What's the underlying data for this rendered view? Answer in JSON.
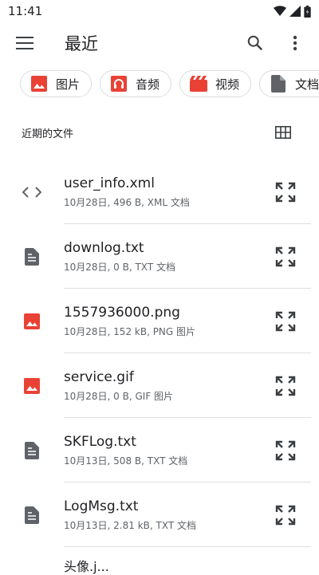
{
  "status": {
    "time": "11:41"
  },
  "appbar": {
    "title": "最近"
  },
  "chips": [
    {
      "label": "图片",
      "color": "#e94235"
    },
    {
      "label": "音频",
      "color": "#e94235"
    },
    {
      "label": "视频",
      "color": "#e94235"
    },
    {
      "label": "文档",
      "color": "#5f6368"
    }
  ],
  "section": {
    "title": "近期的文件"
  },
  "files": [
    {
      "name": "user_info.xml",
      "meta": "10月28日, 496 B, XML 文档",
      "icon": "code-icon"
    },
    {
      "name": "downlog.txt",
      "meta": "10月28日, 0 B, TXT 文档",
      "icon": "document-icon"
    },
    {
      "name": "1557936000.png",
      "meta": "10月28日, 152 kB, PNG 图片",
      "icon": "image-icon"
    },
    {
      "name": "service.gif",
      "meta": "10月28日, 0 B, GIF 图片",
      "icon": "image-icon"
    },
    {
      "name": "SKFLog.txt",
      "meta": "10月13日, 508 B, TXT 文档",
      "icon": "document-icon"
    },
    {
      "name": "LogMsg.txt",
      "meta": "10月13日, 2.81 kB, TXT 文档",
      "icon": "document-icon"
    }
  ],
  "partial_item": "头像.j..."
}
